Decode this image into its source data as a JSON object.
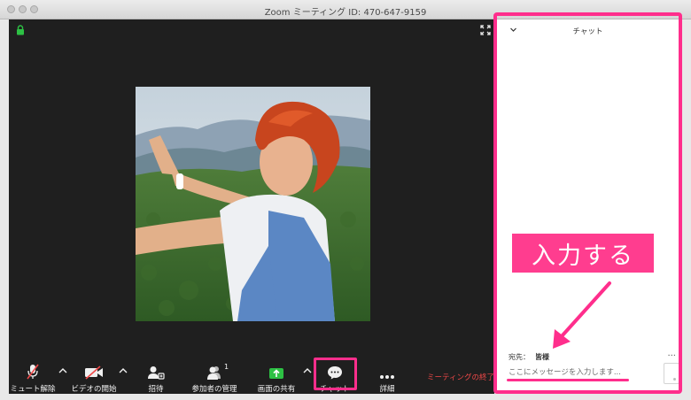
{
  "window": {
    "title": "Zoom ミーティング ID: 470-647-9159"
  },
  "toolbar": {
    "unmute_label": "ミュート解除",
    "start_video_label": "ビデオの開始",
    "invite_label": "招待",
    "participants_label": "参加者の管理",
    "participants_count": "1",
    "share_label": "画面の共有",
    "chat_label": "チャット",
    "more_label": "詳細",
    "end_meeting_label": "ミーティングの終了"
  },
  "chat": {
    "title": "チャット",
    "recipient_prefix": "宛先：",
    "recipient": "皆様",
    "input_placeholder": "ここにメッセージを入力します...",
    "more": "..."
  },
  "annotation": {
    "callout_text": "入力する"
  },
  "colors": {
    "highlight": "#ff2e8c",
    "callout": "#ff3d8f",
    "end_meeting": "#f04848",
    "toolbar_bg": "#1f1f1f",
    "share_green": "#2dc144"
  }
}
